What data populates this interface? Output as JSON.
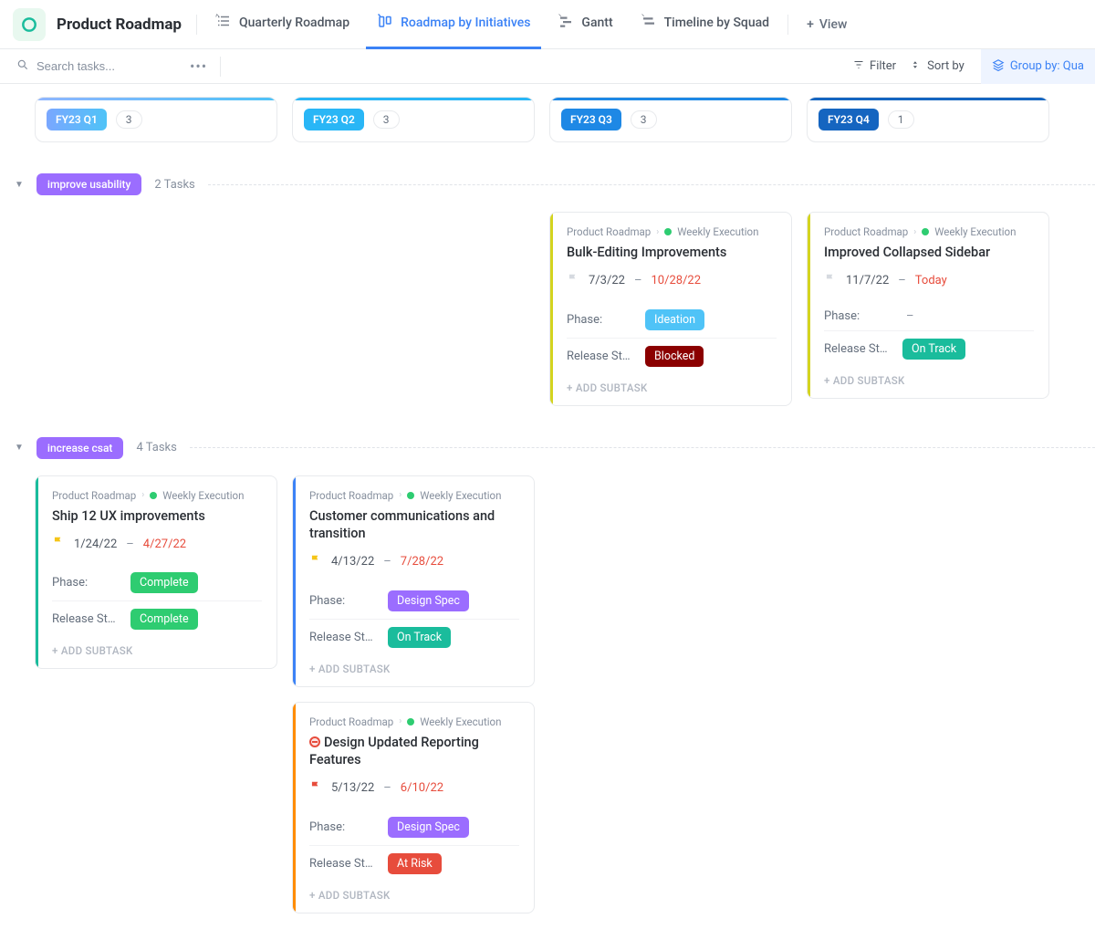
{
  "header": {
    "title": "Product Roadmap",
    "tabs": [
      {
        "label": "Quarterly Roadmap"
      },
      {
        "label": "Roadmap by Initiatives"
      },
      {
        "label": "Gantt"
      },
      {
        "label": "Timeline by Squad"
      }
    ],
    "add_view": "View"
  },
  "toolbar": {
    "search_placeholder": "Search tasks...",
    "filter": "Filter",
    "sort": "Sort by",
    "groupby": "Group by: Qua"
  },
  "columns": [
    {
      "label": "FY23 Q1",
      "count": "3"
    },
    {
      "label": "FY23 Q2",
      "count": "3"
    },
    {
      "label": "FY23 Q3",
      "count": "3"
    },
    {
      "label": "FY23 Q4",
      "count": "1"
    }
  ],
  "groups": [
    {
      "name": "improve usability",
      "count_text": "2 Tasks",
      "slots": [
        [],
        [],
        [
          {
            "crumb1": "Product Roadmap",
            "crumb2": "Weekly Execution",
            "title": "Bulk-Editing Improvements",
            "flag": "gray",
            "start": "7/3/22",
            "end": "10/28/22",
            "phase_label": "Phase:",
            "phase": "Ideation",
            "phase_class": "pill-ideation",
            "release_label": "Release St…",
            "release": "Blocked",
            "release_class": "pill-blocked",
            "stripe": "stripe-yellow",
            "add": "+ ADD SUBTASK"
          }
        ],
        [
          {
            "crumb1": "Product Roadmap",
            "crumb2": "Weekly Execution",
            "title": "Improved Collapsed Sidebar",
            "flag": "gray",
            "start": "11/7/22",
            "end": "Today",
            "phase_label": "Phase:",
            "phase_dash": "–",
            "release_label": "Release St…",
            "release": "On Track",
            "release_class": "pill-ontrack",
            "stripe": "stripe-yellow",
            "add": "+ ADD SUBTASK"
          }
        ]
      ]
    },
    {
      "name": "increase csat",
      "count_text": "4 Tasks",
      "slots": [
        [
          {
            "crumb1": "Product Roadmap",
            "crumb2": "Weekly Execution",
            "title": "Ship 12 UX improvements",
            "flag": "yellow",
            "start": "1/24/22",
            "end": "4/27/22",
            "phase_label": "Phase:",
            "phase": "Complete",
            "phase_class": "pill-complete",
            "release_label": "Release St…",
            "release": "Complete",
            "release_class": "pill-complete",
            "stripe": "stripe-teal",
            "add": "+ ADD SUBTASK"
          }
        ],
        [
          {
            "crumb1": "Product Roadmap",
            "crumb2": "Weekly Execution",
            "title": "Customer communications and tran­sition",
            "flag": "yellow",
            "start": "4/13/22",
            "end": "7/28/22",
            "phase_label": "Phase:",
            "phase": "Design Spec",
            "phase_class": "pill-design",
            "release_label": "Release St…",
            "release": "On Track",
            "release_class": "pill-ontrack",
            "stripe": "stripe-blue",
            "add": "+ ADD SUBTASK"
          },
          {
            "crumb1": "Product Roadmap",
            "crumb2": "Weekly Execution",
            "title_blocked": true,
            "title": "Design Updated Reporting Features",
            "flag": "red",
            "start": "5/13/22",
            "end": "6/10/22",
            "phase_label": "Phase:",
            "phase": "Design Spec",
            "phase_class": "pill-design",
            "release_label": "Release St…",
            "release": "At Risk",
            "release_class": "pill-atrisk",
            "stripe": "stripe-orange",
            "add": "+ ADD SUBTASK"
          }
        ],
        [],
        []
      ]
    }
  ]
}
